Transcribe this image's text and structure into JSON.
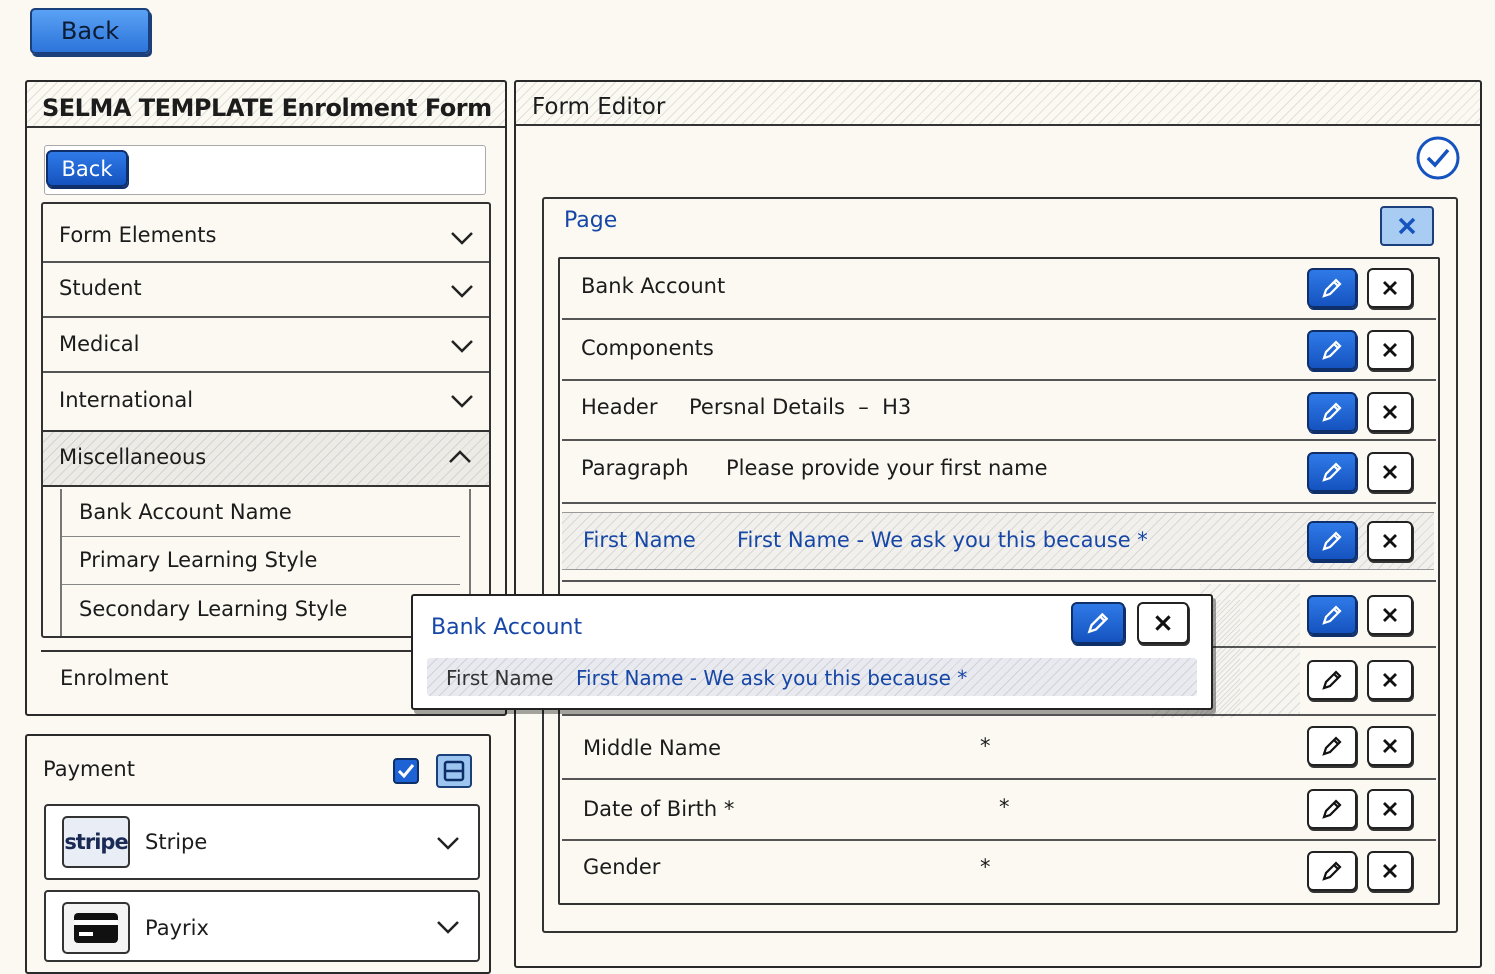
{
  "top_back_label": "Back",
  "left_panel": {
    "title": "SELMA TEMPLATE Enrolment Form",
    "back_label": "Back",
    "sections": [
      {
        "label": "Form Elements"
      },
      {
        "label": "Student"
      },
      {
        "label": "Medical"
      },
      {
        "label": "International"
      },
      {
        "label": "Miscellaneous"
      }
    ],
    "misc_items": [
      "Bank Account Name",
      "Primary Learning Style",
      "Secondary Learning Style"
    ],
    "enrolment_label": "Enrolment"
  },
  "payment": {
    "title": "Payment",
    "methods": [
      {
        "logo": "stripe",
        "label": "Stripe"
      },
      {
        "label": "Payrix"
      }
    ]
  },
  "editor": {
    "title": "Form Editor",
    "page_label": "Page",
    "rows": [
      {
        "type": "Bank Account",
        "detail": ""
      },
      {
        "type": "Components",
        "detail": ""
      },
      {
        "type": "Header",
        "detail": "Persnal Details  –  H3"
      },
      {
        "type": "Paragraph",
        "detail": "Please provide your first name"
      },
      {
        "type": "First Name",
        "detail": "First Name - We ask you this because *"
      },
      {
        "type": "Middle Name",
        "detail": "*"
      },
      {
        "type": "Date of Birth *",
        "detail": "*"
      },
      {
        "type": "Gender",
        "detail": "*"
      }
    ]
  },
  "drag_overlay": {
    "title": "Bank Account",
    "field_type": "First Name",
    "field_detail": "First Name - We ask you this because *"
  },
  "colors": {
    "accent": "#2c74d9",
    "dark_blue": "#1553bf",
    "link_blue": "#1747a6",
    "background": "#fbf9f2"
  }
}
